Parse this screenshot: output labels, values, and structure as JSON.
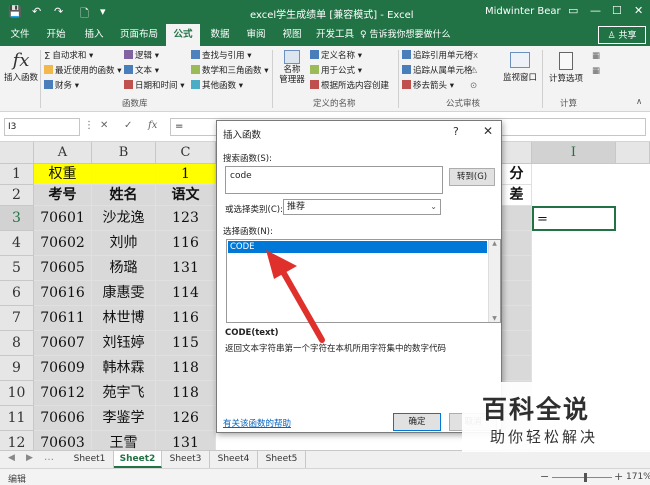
{
  "window": {
    "quick_access": [
      "💾",
      "↶",
      "↷",
      "🗋",
      "▾"
    ],
    "title": "excel学生成绩单 [兼容模式] - Excel",
    "user": "Midwinter Bear",
    "controls": [
      "▭",
      "—",
      "☐",
      "✕"
    ]
  },
  "tabs": [
    "文件",
    "开始",
    "插入",
    "页面布局",
    "公式",
    "数据",
    "审阅",
    "视图",
    "开发工具"
  ],
  "active_tab": "公式",
  "tell_me": "♀ 告诉我你想要做什么",
  "share": "♙ 共享",
  "ribbon": {
    "insert_function": {
      "icon": "fx",
      "label": "插入函数"
    },
    "library": {
      "autosum": "自动求和 ▾",
      "recent": "最近使用的函数 ▾",
      "financial": "财务 ▾",
      "logical": "逻辑 ▾",
      "text": "文本 ▾",
      "datetime": "日期和时间 ▾",
      "lookup": "查找与引用 ▾",
      "math": "数学和三角函数 ▾",
      "more": "其他函数 ▾",
      "group_label": "函数库"
    },
    "names": {
      "manager": "名称\n管理器",
      "define": "定义名称 ▾",
      "use_in_formula": "用于公式 ▾",
      "create": "根据所选内容创建",
      "group_label": "定义的名称"
    },
    "audit": {
      "trace_precedents": "追踪引用单元格",
      "trace_dependents": "追踪从属单元格",
      "remove_arrows": "移去箭头 ▾",
      "watch": "监视窗口",
      "group_label": "公式审核"
    },
    "calc": {
      "options": "计算选项",
      "group_label": "计算"
    }
  },
  "formula_bar": {
    "name_box": "I3",
    "formula": "="
  },
  "grid": {
    "col_headers": [
      "A",
      "B",
      "C"
    ],
    "right_col_header": "I",
    "rows": [
      {
        "n": "1",
        "a": "权重",
        "b": "",
        "c": "1"
      },
      {
        "n": "2",
        "a": "考号",
        "b": "姓名",
        "c": "语文"
      },
      {
        "n": "3",
        "a": "70601",
        "b": "沙龙逸",
        "c": "123"
      },
      {
        "n": "4",
        "a": "70602",
        "b": "刘帅",
        "c": "116"
      },
      {
        "n": "5",
        "a": "70605",
        "b": "杨璐",
        "c": "131"
      },
      {
        "n": "6",
        "a": "70616",
        "b": "康惠雯",
        "c": "114"
      },
      {
        "n": "7",
        "a": "70611",
        "b": "林世博",
        "c": "116"
      },
      {
        "n": "8",
        "a": "70607",
        "b": "刘钰婷",
        "c": "115"
      },
      {
        "n": "9",
        "a": "70609",
        "b": "韩林霖",
        "c": "118"
      },
      {
        "n": "10",
        "a": "70612",
        "b": "苑宇飞",
        "c": "118"
      },
      {
        "n": "11",
        "a": "70606",
        "b": "李鉴学",
        "c": "126"
      },
      {
        "n": "12",
        "a": "70603",
        "b": "王雪",
        "c": "131"
      },
      {
        "n": "13",
        "a": "70604",
        "b": "韩雨萌",
        "c": "129"
      }
    ],
    "peek_h1": "分",
    "peek_h2": "差",
    "active_cell_value": "="
  },
  "sheets": [
    "Sheet1",
    "Sheet2",
    "Sheet3",
    "Sheet4",
    "Sheet5"
  ],
  "active_sheet": "Sheet2",
  "status": {
    "mode": "编辑",
    "zoom": "171%"
  },
  "dialog": {
    "title": "插入函数",
    "help": "?",
    "close": "✕",
    "search_label": "搜索函数(S):",
    "search_value": "code",
    "go_button": "转到(G)",
    "category_label": "或选择类别(C):",
    "category_value": "推荐",
    "select_label": "选择函数(N):",
    "functions": [
      "CODE"
    ],
    "signature": "CODE(text)",
    "description": "返回文本字符串第一个字符在本机所用字符集中的数字代码",
    "help_link": "有关该函数的帮助",
    "ok": "确定",
    "cancel": "取消"
  },
  "watermark": {
    "line1": "百科全说",
    "line2": "助你轻松解决"
  },
  "colors": {
    "excel_green": "#217346",
    "header_yellow": "#ffff00",
    "selection_blue": "#0078d7",
    "arrow_red": "#e0302b"
  }
}
